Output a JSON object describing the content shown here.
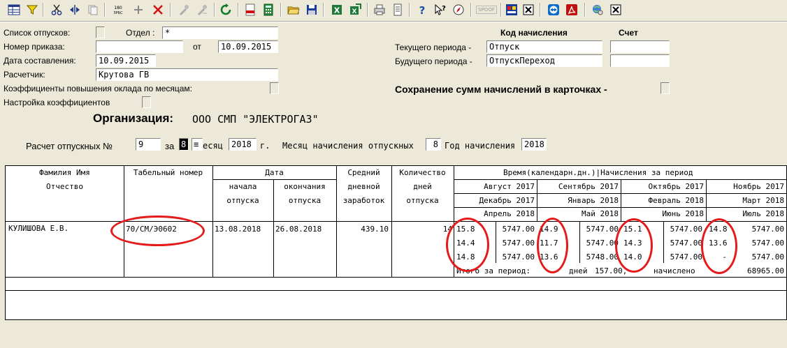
{
  "toolbar": {
    "icons": [
      "table-icon",
      "filter-icon",
      "scissors-icon",
      "split-icon",
      "copy-icon",
      "counter-icon",
      "plus-icon",
      "delete-icon",
      "tool-icon",
      "tool2-icon",
      "refresh-icon",
      "pdf-icon",
      "calculator-icon",
      "open-folder-icon",
      "save-icon",
      "excel-icon",
      "excel-export-icon",
      "print-icon",
      "preview-icon",
      "help-icon",
      "context-help-icon",
      "compass-icon",
      "group-icon",
      "window-icon",
      "close-icon",
      "teamviewer-icon",
      "acrobat-icon",
      "globe-icon",
      "close2-icon"
    ],
    "spoof_label": "SPOOF"
  },
  "form": {
    "vacations_list_label": "Список отпусков:",
    "dept_label": "Отдел :",
    "dept_value": "*",
    "order_label": "Номер приказа:",
    "order_value": "",
    "from_label": "от",
    "from_value": "10.09.2015",
    "compiled_label": "Дата составления:",
    "compiled_value": "10.09.2015",
    "accountant_label": "Расчетчик:",
    "accountant_value": "Крутова ГВ",
    "coef_monthly_label": "Коэффициенты повышения оклада по месяцам:",
    "coef_setup_label": "Настройка коэффициентов",
    "accrual_code_header": "Код начисления",
    "account_header": "Счет",
    "current_period_label": "Текущего периода -",
    "current_period_value": "Отпуск",
    "current_account_value": "",
    "future_period_label": "Будущего периода -",
    "future_period_value": "ОтпускПереход",
    "future_account_value": "",
    "save_sums_label": "Сохранение сумм начислений в карточках -",
    "org_label": "Организация:",
    "org_value": "ООО СМП \"ЭЛЕКТРОГАЗ\"",
    "calc_label": "Расчет отпускных №",
    "calc_value": "9",
    "za_label": "за",
    "month_value": "8",
    "month_label": "есяц",
    "year_value": "2018",
    "year_suffix": "г.",
    "accrual_month_label": "Месяц начисления отпускных",
    "accrual_month_value": "8",
    "accrual_year_label": "Год начисления",
    "accrual_year_value": "2018"
  },
  "table": {
    "headers": {
      "name1": "Фамилия Имя",
      "name2": "Отчество",
      "tab": "Табельный номер",
      "date": "Дата",
      "start1": "начала",
      "start2": "отпуска",
      "end1": "окончания",
      "end2": "отпуска",
      "avg1": "Средний",
      "avg2": "дневной",
      "avg3": "заработок",
      "qty1": "Количество",
      "qty2": "дней",
      "qty3": "отпуска",
      "time_header": "Время(календарн.дн.)|Начисления за период"
    },
    "months": [
      [
        "Август 2017",
        "Сентябрь 2017",
        "Октябрь 2017",
        "Ноябрь 2017"
      ],
      [
        "Декабрь 2017",
        "Январь 2018",
        "Февраль 2018",
        "Март 2018"
      ],
      [
        "Апрель 2018",
        "Май 2018",
        "Июнь 2018",
        "Июль 2018"
      ]
    ],
    "row": {
      "name": "КУЛИШОВА Е.В.",
      "tab_number": "70/СМ/Э0602",
      "start": "13.08.2018",
      "end": "26.08.2018",
      "avg": "439.10",
      "days": "14"
    },
    "values": [
      [
        [
          "15.8",
          "5747.00"
        ],
        [
          "14.9",
          "5747.00"
        ],
        [
          "15.1",
          "5747.00"
        ],
        [
          "14.8",
          "5747.00"
        ]
      ],
      [
        [
          "14.4",
          "5747.00"
        ],
        [
          "11.7",
          "5747.00"
        ],
        [
          "14.3",
          "5747.00"
        ],
        [
          "13.6",
          "5747.00"
        ]
      ],
      [
        [
          "14.8",
          "5747.00"
        ],
        [
          "13.6",
          "5748.00"
        ],
        [
          "14.0",
          "5747.00"
        ],
        [
          "-",
          "5747.00"
        ]
      ]
    ],
    "total_label": "Итого за период:",
    "total_days_label": "дней",
    "total_days": "157.00,",
    "total_accrued_label": "начислено",
    "total_accrued": "68965.00"
  },
  "colors": {
    "annotation": "#e41b1b",
    "background": "#ece9d8"
  }
}
